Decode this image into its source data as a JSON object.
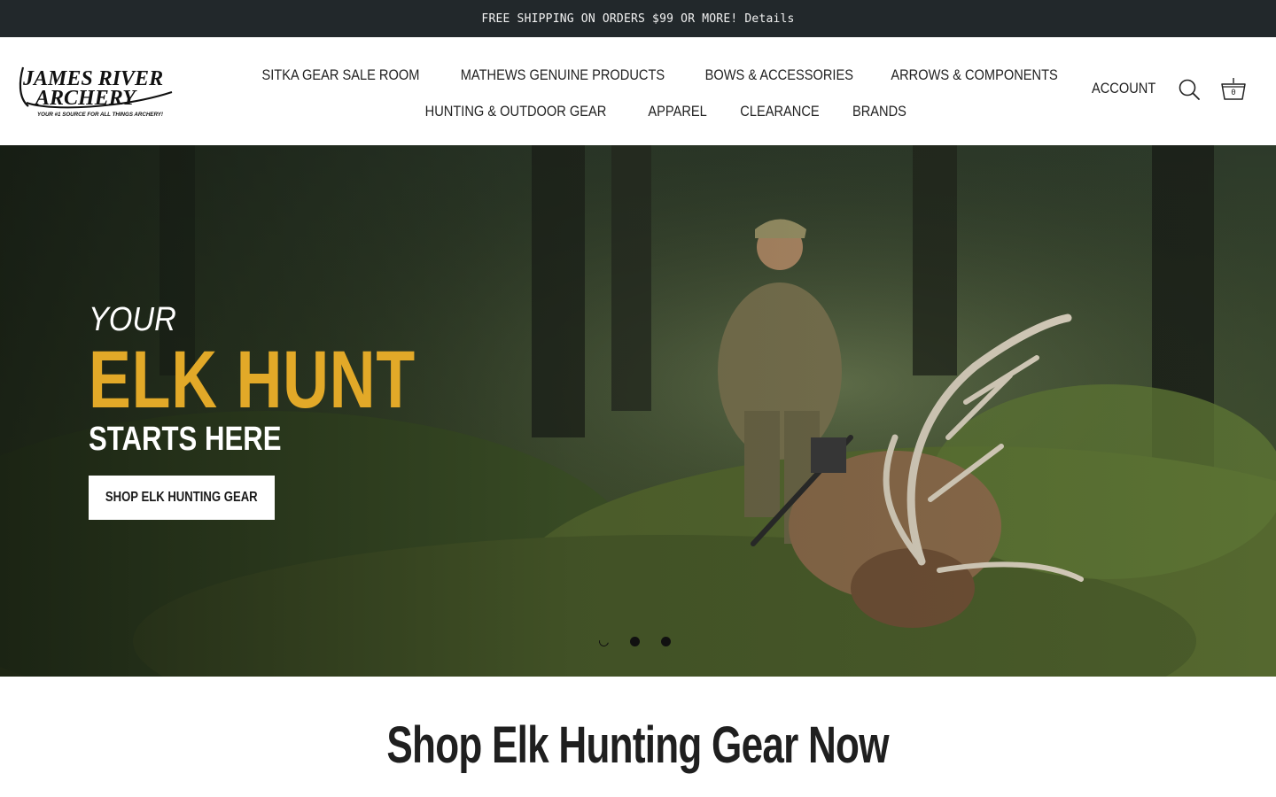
{
  "announcement": {
    "text": "FREE SHIPPING ON ORDERS $99 OR MORE!",
    "link": "Details"
  },
  "brand": {
    "logo_line1": "JAMES RIVER",
    "logo_line2": "ARCHERY",
    "tagline": "YOUR #1 SOURCE FOR ALL THINGS ARCHERY!"
  },
  "nav": {
    "row1": [
      "SITKA GEAR SALE ROOM",
      "MATHEWS GENUINE PRODUCTS",
      "BOWS & ACCESSORIES",
      "ARROWS & COMPONENTS"
    ],
    "row2": [
      "HUNTING & OUTDOOR GEAR",
      "APPAREL",
      "CLEARANCE",
      "BRANDS"
    ]
  },
  "header_actions": {
    "account": "ACCOUNT",
    "search_icon": "search-icon",
    "cart_icon": "basket-icon",
    "cart_count": "0"
  },
  "hero": {
    "eyebrow": "YOUR",
    "title": "ELK HUNT",
    "subtitle": "STARTS HERE",
    "cta": "SHOP ELK HUNTING GEAR",
    "slides_total": 3,
    "active_slide": 1,
    "accent_color": "#e2a928"
  },
  "section": {
    "title": "Shop Elk Hunting Gear Now"
  }
}
